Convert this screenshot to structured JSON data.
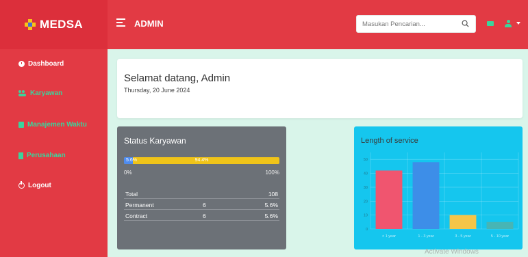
{
  "header": {
    "brand": "MEDSA",
    "title": "ADMIN",
    "search_placeholder": "Masukan Pencarian..."
  },
  "sidebar": {
    "items": [
      {
        "label": "Dashboard",
        "icon": "dashboard-icon"
      },
      {
        "label": "Karyawan",
        "icon": "users-icon"
      },
      {
        "label": "Manajemen Waktu",
        "icon": "calendar-icon"
      },
      {
        "label": "Perusahaan",
        "icon": "building-icon"
      },
      {
        "label": "Logout",
        "icon": "power-icon"
      }
    ]
  },
  "welcome": {
    "heading": "Selamat datang, Admin",
    "date": "Thursday, 20 June 2024"
  },
  "status": {
    "title": "Status Karyawan",
    "bar_left_label": "5.6%",
    "bar_mid_label": "94.4%",
    "bar_fraction": 0.056,
    "min_label": "0%",
    "max_label": "100%",
    "rows": [
      {
        "label": "Total",
        "count": "",
        "value": "108"
      },
      {
        "label": "Permanent",
        "count": "6",
        "value": "5.6%"
      },
      {
        "label": "Contract",
        "count": "6",
        "value": "5.6%"
      }
    ]
  },
  "chart_data": {
    "type": "bar",
    "title": "Length of service",
    "categories": [
      "< 1 year",
      "1 - 3 year",
      "3 - 5 year",
      "5 - 10 year"
    ],
    "values": [
      42,
      48,
      10,
      5
    ],
    "colors": [
      "#f0556f",
      "#3d8ee8",
      "#f5c548",
      "#47b5b5"
    ],
    "yticks": [
      0,
      10,
      20,
      30,
      40,
      50
    ],
    "ylim": [
      0,
      55
    ],
    "grid": true
  },
  "colors": {
    "primary_red": "#e23a44",
    "accent_green": "#3bd49c",
    "chart_bg": "#15c6ee",
    "status_card_bg": "#6c7177"
  },
  "watermark": "Activate Windows"
}
